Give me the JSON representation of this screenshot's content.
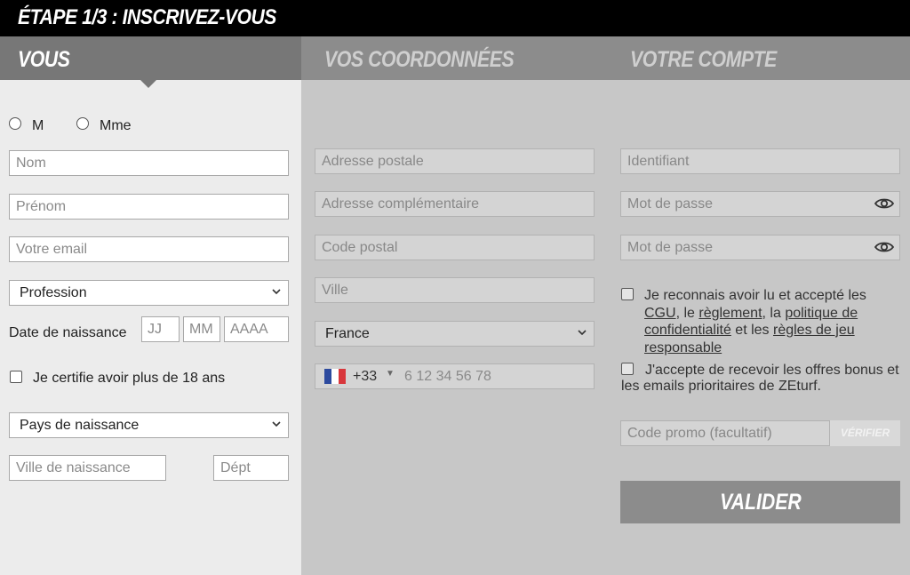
{
  "header": {
    "title": "ÉTAPE 1/3 : INSCRIVEZ-VOUS"
  },
  "tabs": [
    {
      "label": "VOUS",
      "active": true
    },
    {
      "label": "VOS COORDONNÉES",
      "active": false
    },
    {
      "label": "VOTRE COMPTE",
      "active": false
    }
  ],
  "you": {
    "civility": {
      "option_m": "M",
      "option_mme": "Mme"
    },
    "last_name_placeholder": "Nom",
    "first_name_placeholder": "Prénom",
    "email_placeholder": "Votre email",
    "profession_value": "Profession",
    "birthdate_label": "Date de naissance",
    "day_placeholder": "JJ",
    "month_placeholder": "MM",
    "year_placeholder": "AAAA",
    "age_certify_label": "Je certifie avoir plus de 18 ans",
    "birth_country_value": "Pays de naissance",
    "birth_city_placeholder": "Ville de naissance",
    "department_placeholder": "Dépt"
  },
  "contact": {
    "address_placeholder": "Adresse postale",
    "address2_placeholder": "Adresse complémentaire",
    "postal_code_placeholder": "Code postal",
    "city_placeholder": "Ville",
    "country_value": "France",
    "phone_code": "+33",
    "phone_placeholder": "6 12 34 56 78"
  },
  "account": {
    "username_placeholder": "Identifiant",
    "password_placeholder": "Mot de passe",
    "password_confirm_placeholder": "Mot de passe",
    "terms": {
      "prefix": "Je reconnais avoir lu et accepté les",
      "cgu": "CGU",
      "sep1": ", le",
      "reglement": "règlement",
      "sep2": ", la",
      "politique": "politique de confidentialité",
      "sep3": "et les",
      "regles": "règles de jeu responsable"
    },
    "offers_label": "J'accepte de recevoir les offres bonus et les emails prioritaires de ZEturf.",
    "promo_placeholder": "Code promo (facultatif)",
    "verify_label": "VÉRIFIER",
    "submit_label": "VALIDER"
  },
  "colors": {
    "header_bg": "#000000",
    "tab_bg": "#8c8c8c",
    "tab_active_bg": "#777777",
    "panel_active": "#ececec",
    "panel_inactive": "#c7c7c7",
    "flag_blue": "#2c4a9e",
    "flag_white": "#ffffff",
    "flag_red": "#d8373c"
  },
  "icons": [
    "eye-icon",
    "chevron-down-icon",
    "france-flag-icon",
    "caret-down-icon"
  ]
}
